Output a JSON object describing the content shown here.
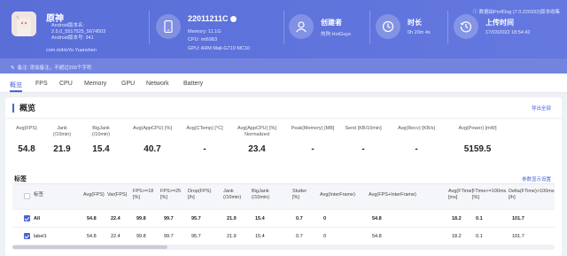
{
  "app": {
    "name": "原神",
    "version_lines": [
      "Android版本名:",
      "2.5.0_5517525_5674503",
      "Android版本号: 341"
    ],
    "package": "com.miHoYo.Yuanshen"
  },
  "device": {
    "model": "22011211C",
    "memory": "Memory: 11.1G",
    "cpu": "CPU: mt6983",
    "gpu": "GPU: ARM Mali-G710 MC10"
  },
  "creator": {
    "title": "创建者",
    "value": "热狗 HotGuys"
  },
  "duration": {
    "title": "时长",
    "value": "0h 20m 4s"
  },
  "upload": {
    "title": "上传时间",
    "value": "17/03/2022 18:54:42"
  },
  "collector_note": "数据由PerfDog (7.0.220332)版本收集",
  "note_placeholder": "备注: 添加备注，不超过200个字符",
  "tabs": [
    "概览",
    "FPS",
    "CPU",
    "Memory",
    "GPU",
    "Network",
    "Battery"
  ],
  "overview": {
    "title": "概览",
    "export": "导出全部",
    "stats": [
      {
        "label": "Avg(FPS)",
        "value": "54.8"
      },
      {
        "label": "Jank\n(/10min)",
        "value": "21.9"
      },
      {
        "label": "BigJank\n(/10min)",
        "value": "15.4"
      },
      {
        "label": "Avg(AppCPU) [%]",
        "value": "40.7"
      },
      {
        "label": "Avg(CTemp) [°C]",
        "value": "-"
      },
      {
        "label": "Avg(AppCPU) [%]\nNormalized",
        "value": "23.4"
      },
      {
        "label": "Peak(Memory) [MB]",
        "value": "-"
      },
      {
        "label": "Send [KB/10min]",
        "value": "-"
      },
      {
        "label": "Avg(Recv) [KB/s]",
        "value": "-"
      },
      {
        "label": "Avg(Power) [mW]",
        "value": "5159.5"
      }
    ]
  },
  "labels_section": {
    "title": "标签",
    "settings": "参数显示设置",
    "headers": [
      "标签",
      "Avg(FPS)",
      "Var(FPS)",
      "FPS>=18\n[%]",
      "FPS>=25\n[%]",
      "Drop(FPS)\n[/h]",
      "Jank\n(/10min)",
      "BigJank\n(/10min)",
      "Stutter\n[%]",
      "Avg(InterFrame)",
      "Avg(FPS+InterFrame)",
      "Avg(FTime)\n[ms]",
      "FTime>=100ms\n[%]",
      "Delta(FTime)>100ms\n[/h]"
    ],
    "rows": [
      {
        "label": "All",
        "values": [
          "54.8",
          "22.4",
          "99.8",
          "99.7",
          "95.7",
          "21.9",
          "15.4",
          "0.7",
          "0",
          "54.8",
          "18.2",
          "0.1",
          "101.7"
        ]
      },
      {
        "label": "label1",
        "values": [
          "54.8",
          "22.4",
          "99.8",
          "99.7",
          "95.7",
          "21.9",
          "15.4",
          "0.7",
          "0",
          "54.8",
          "18.2",
          "0.1",
          "101.7"
        ]
      }
    ]
  },
  "colors": {
    "header": "#5b6fd8",
    "accent": "#4a63d6"
  },
  "icons": [
    "app-icon",
    "phone-icon",
    "user-icon",
    "clock-icon",
    "history-icon",
    "edit-icon",
    "checkbox-icon"
  ]
}
